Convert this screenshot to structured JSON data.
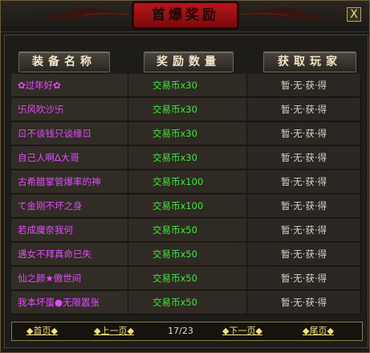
{
  "window": {
    "title": "首爆奖励",
    "close_label": "X"
  },
  "table": {
    "headers": [
      "装备名称",
      "奖励数量",
      "获取玩家"
    ],
    "rows": [
      {
        "name": "✿过年好✿",
        "reward": "交易币x30",
        "player": "暂·无·获·得"
      },
      {
        "name": "卐风吹沙卐",
        "reward": "交易币x30",
        "player": "暂·无·获·得"
      },
      {
        "name": "ㄖ不谈钱只谈缘ㄖ",
        "reward": "交易币x30",
        "player": "暂·无·获·得"
      },
      {
        "name": "自己人啊∆大哥",
        "reward": "交易币x30",
        "player": "暂·无·获·得"
      },
      {
        "name": "古希腊掌管爆率的神",
        "reward": "交易币x100",
        "player": "暂·无·获·得"
      },
      {
        "name": "て金刚不坏之身",
        "reward": "交易币x100",
        "player": "暂·无·获·得"
      },
      {
        "name": "若成魔奈我何",
        "reward": "交易币x50",
        "player": "暂·无·获·得"
      },
      {
        "name": "遇女不拜真命已失",
        "reward": "交易币x50",
        "player": "暂·无·获·得"
      },
      {
        "name": "仙之颜★傲世间",
        "reward": "交易币x50",
        "player": "暂·无·获·得"
      },
      {
        "name": "我本坏蛋●无限嚣张",
        "reward": "交易币x50",
        "player": "暂·无·获·得"
      }
    ]
  },
  "pager": {
    "first": "◆首页◆",
    "prev": "◆上一页◆",
    "page_indicator": "17/23",
    "next": "◆下一页◆",
    "last": "◆尾页◆"
  },
  "colors": {
    "name_text": "#e24bff",
    "reward_text": "#3be83b",
    "player_text": "#d8d4c8",
    "pager_link": "#f2e27a"
  }
}
